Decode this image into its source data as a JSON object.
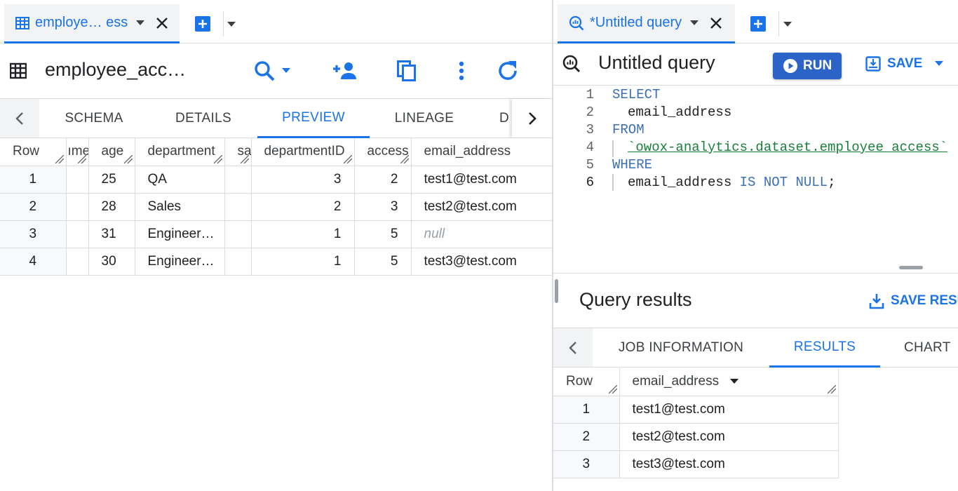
{
  "left": {
    "tab": {
      "label": "employe… ess"
    },
    "toolbar": {
      "title": "employee_acc…"
    },
    "subtabs": [
      "SCHEMA",
      "DETAILS",
      "PREVIEW",
      "LINEAGE",
      "D"
    ],
    "table": {
      "headers": [
        "Row",
        "ıme",
        "age",
        "department",
        "sa",
        "departmentID",
        "access",
        "email_address"
      ],
      "rows": [
        [
          "1",
          "",
          "25",
          "QA",
          "",
          "3",
          "2",
          "test1@test.com"
        ],
        [
          "2",
          "",
          "28",
          "Sales",
          "",
          "2",
          "3",
          "test2@test.com"
        ],
        [
          "3",
          "",
          "31",
          "Engineer…",
          "",
          "1",
          "5",
          "null"
        ],
        [
          "4",
          "",
          "30",
          "Engineer…",
          "",
          "1",
          "5",
          "test3@test.com"
        ]
      ]
    }
  },
  "right": {
    "tab": {
      "label": "*Untitled query"
    },
    "toolbar": {
      "title": "Untitled query",
      "run_label": "RUN",
      "save_label": "SAVE"
    },
    "editor": {
      "line_numbers": [
        "1",
        "2",
        "3",
        "4",
        "5",
        "6"
      ],
      "lines": {
        "l1": "SELECT",
        "l2": "email_address",
        "l3": "FROM",
        "l4": "`owox-analytics.dataset.employee_access`",
        "l5": "WHERE",
        "l6_a": "email_address ",
        "l6_b": "IS NOT NULL",
        "l6_c": ";"
      }
    },
    "results": {
      "title": "Query results",
      "save_results_label": "SAVE RESU",
      "tabs": [
        "JOB INFORMATION",
        "RESULTS",
        "CHART"
      ],
      "headers": [
        "Row",
        "email_address"
      ],
      "rows": [
        [
          "1",
          "test1@test.com"
        ],
        [
          "2",
          "test2@test.com"
        ],
        [
          "3",
          "test3@test.com"
        ]
      ]
    }
  },
  "colors": {
    "accent": "#1a73e8",
    "run_button": "#2b63c6",
    "keyword": "#3b6fb6",
    "string": "#188038"
  }
}
